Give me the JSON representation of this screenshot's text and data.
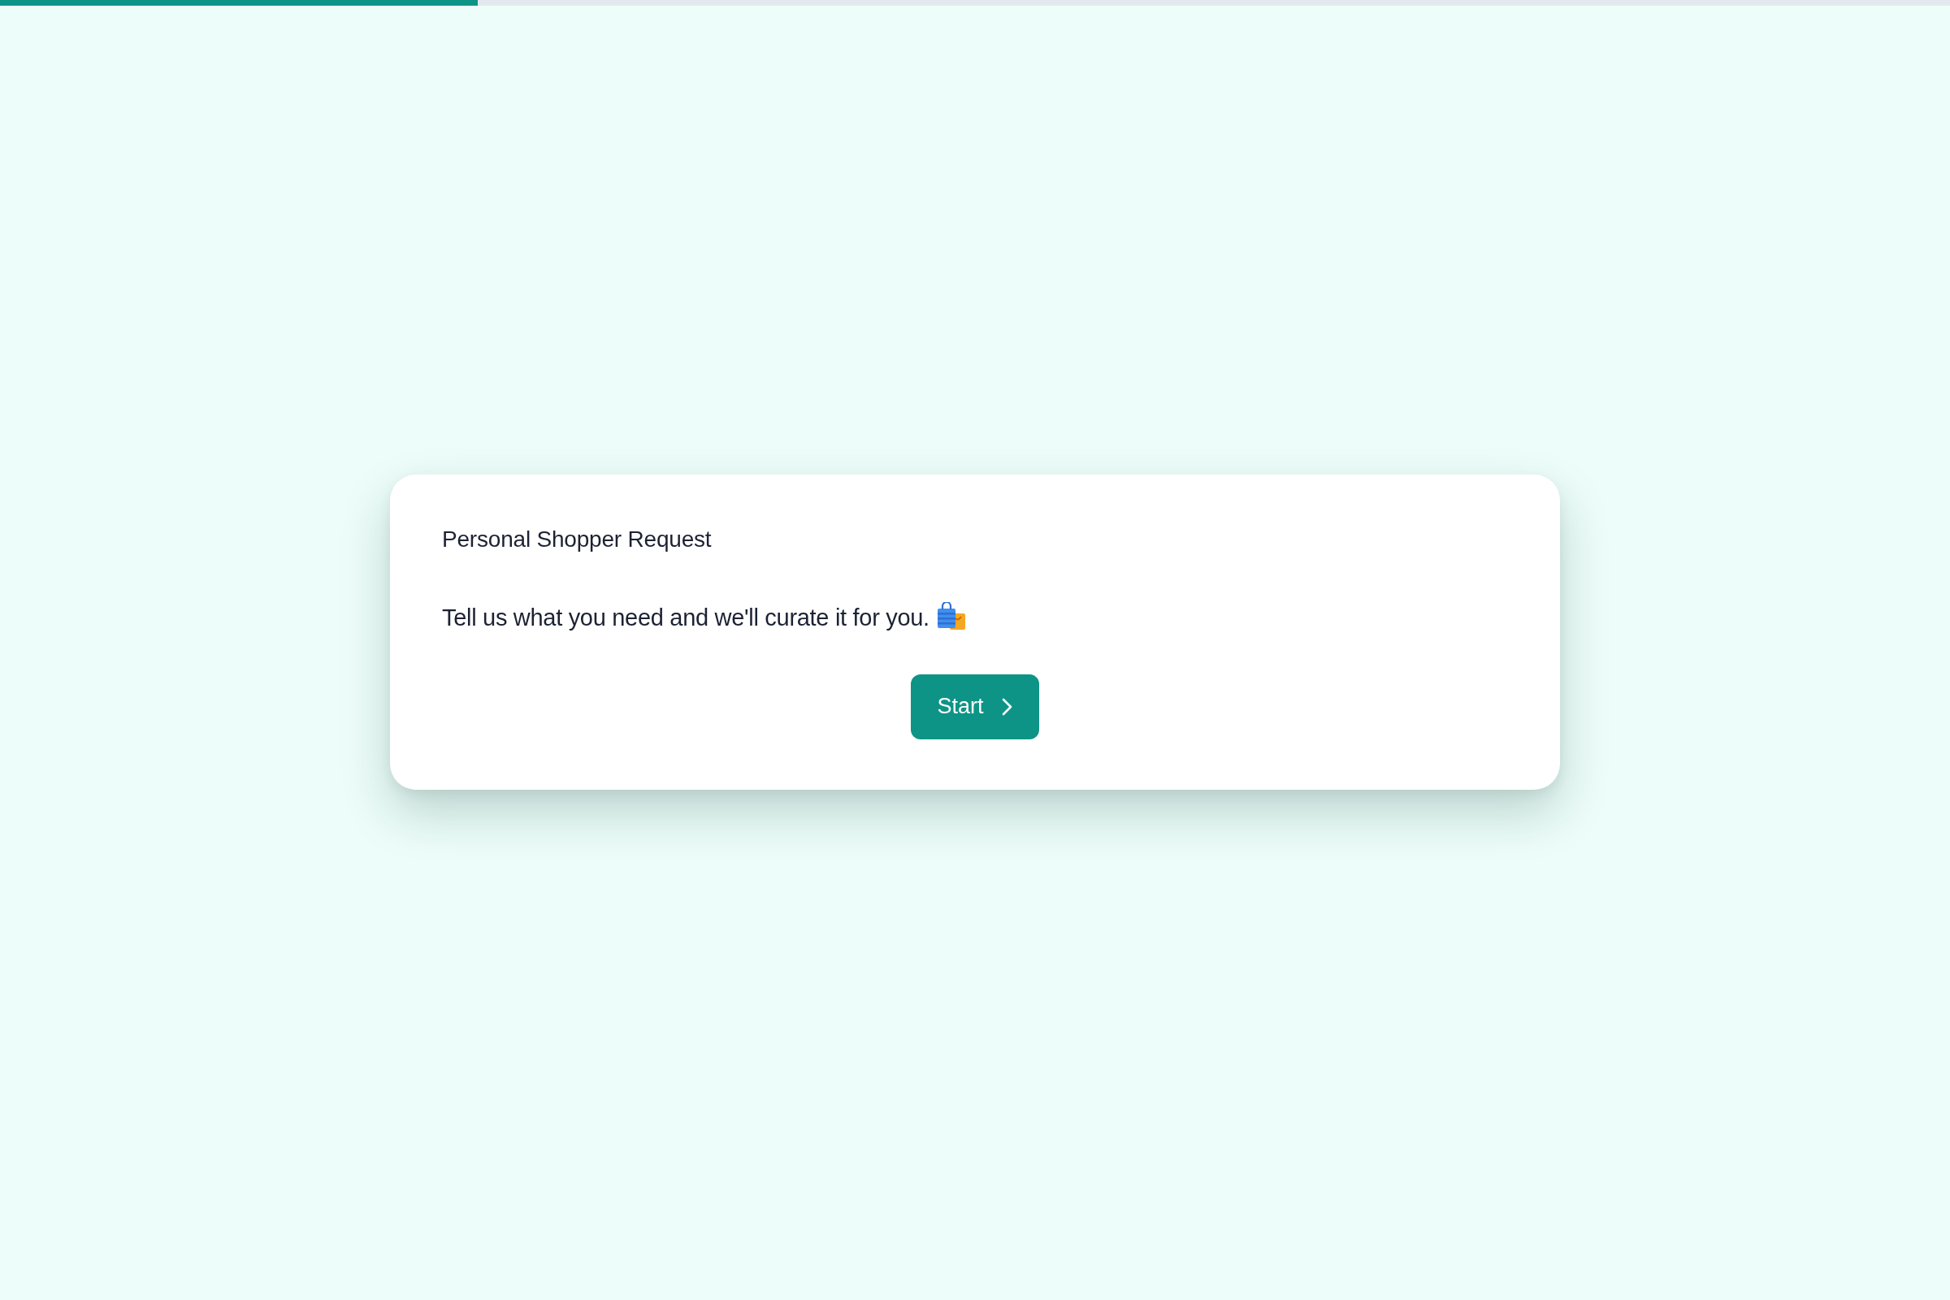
{
  "progress": {
    "level": 0.245
  },
  "card": {
    "title": "Personal Shopper Request",
    "description": "Tell us what you need and we'll curate it for you.",
    "button": {
      "label": "Start"
    }
  }
}
